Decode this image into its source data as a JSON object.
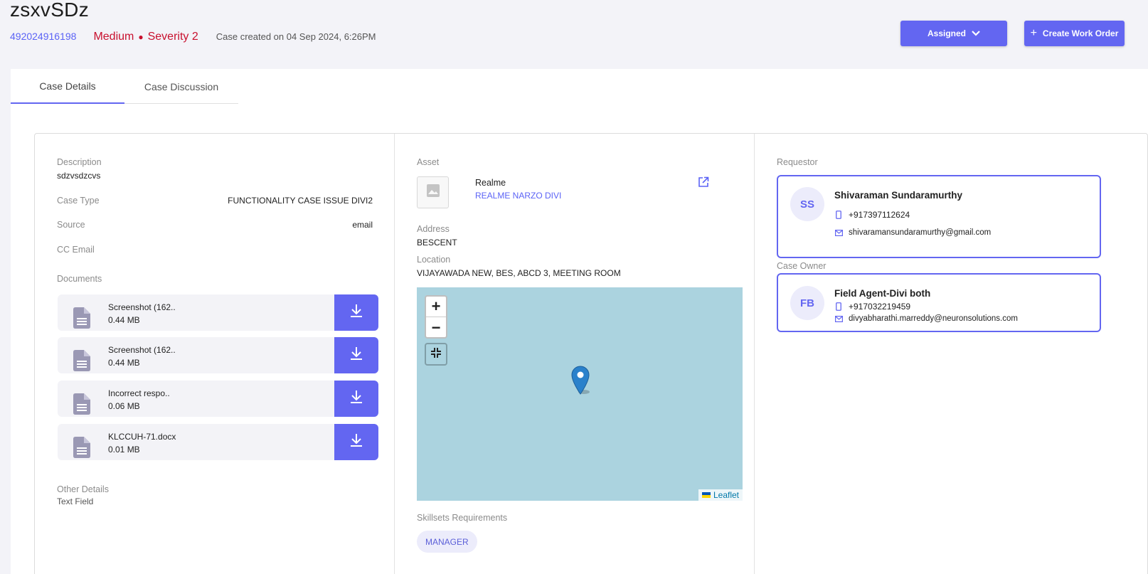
{
  "case": {
    "title": "zsxvSDz",
    "id": "492024916198",
    "priority": "Medium",
    "severity": "Severity 2",
    "created": "Case created on 04 Sep 2024, 6:26PM"
  },
  "actions": {
    "assigned_label": "Assigned",
    "create_label": "Create Work Order"
  },
  "tabs": [
    {
      "label": "Case Details",
      "active": true
    },
    {
      "label": "Case Discussion",
      "active": false
    }
  ],
  "details": {
    "description_label": "Description",
    "description": "sdzvsdzcvs",
    "case_type_label": "Case Type",
    "case_type": "FUNCTIONALITY CASE ISSUE DIVI2",
    "source_label": "Source",
    "source": "email",
    "cc_email_label": "CC Email",
    "documents_label": "Documents",
    "documents": [
      {
        "name": "Screenshot (162..",
        "size": "0.44 MB"
      },
      {
        "name": "Screenshot (162..",
        "size": "0.44 MB"
      },
      {
        "name": "Incorrect respo..",
        "size": "0.06 MB"
      },
      {
        "name": "KLCCUH-71.docx",
        "size": "0.01 MB"
      }
    ],
    "other_label": "Other Details",
    "other_value": "Text Field"
  },
  "asset": {
    "label": "Asset",
    "name": "Realme",
    "model": "REALME NARZO DIVI",
    "address_label": "Address",
    "address": "BESCENT",
    "location_label": "Location",
    "location": "VIJAYAWADA NEW, BES, ABCD 3, MEETING ROOM",
    "map": {
      "zoom_in": "+",
      "zoom_out": "−",
      "attribution": "Leaflet"
    },
    "skills_label": "Skillsets Requirements",
    "skills": [
      "MANAGER"
    ]
  },
  "people": {
    "requestor_label": "Requestor",
    "requestor": {
      "initials": "SS",
      "name": "Shivaraman Sundaramurthy",
      "phone": "+917397112624",
      "email": "shivaramansundaramurthy@gmail.com"
    },
    "owner_label": "Case Owner",
    "owner": {
      "initials": "FB",
      "name": "Field Agent-Divi both",
      "phone": "+917032219459",
      "email": "divyabharathi.marreddy@neuronsolutions.com"
    }
  },
  "colors": {
    "accent": "#6366f1",
    "priority": "#c8102e",
    "map_water": "#abd3df"
  }
}
